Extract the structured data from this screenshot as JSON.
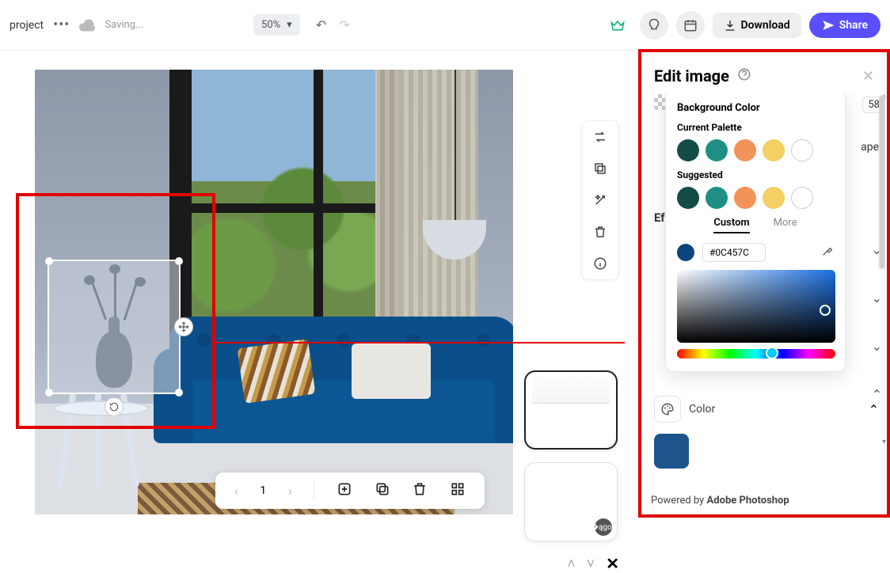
{
  "topbar": {
    "project_label": "project",
    "saving": "Saving...",
    "zoom": "50%",
    "download": "Download",
    "share": "Share"
  },
  "bottombar": {
    "page": "1"
  },
  "panel": {
    "title": "Edit image",
    "num_top_right": "58",
    "effects_label": "Ef",
    "ape_fragment": "ape",
    "color_label": "Color",
    "footer_prefix": "Powered by ",
    "footer_brand": "Adobe Photoshop"
  },
  "popover": {
    "title": "Background Color",
    "current_label": "Current Palette",
    "suggested_label": "Suggested",
    "tab_custom": "Custom",
    "tab_more": "More",
    "hex": "#0C457C",
    "palette_current": [
      "#134c46",
      "#1f8f86",
      "#f2935a",
      "#f4cf63",
      "outline"
    ],
    "palette_suggested": [
      "#134c46",
      "#1f8f86",
      "#f2935a",
      "#f4cf63",
      "outline"
    ]
  },
  "icons": {
    "crown": "crown-icon",
    "bulb": "bulb-icon",
    "calendar": "calendar-icon",
    "download": "download-icon",
    "send": "send-icon",
    "swap": "swap-icon",
    "duplicate": "duplicate-icon",
    "magic": "magic-icon",
    "trash": "trash-icon",
    "info": "info-icon"
  }
}
